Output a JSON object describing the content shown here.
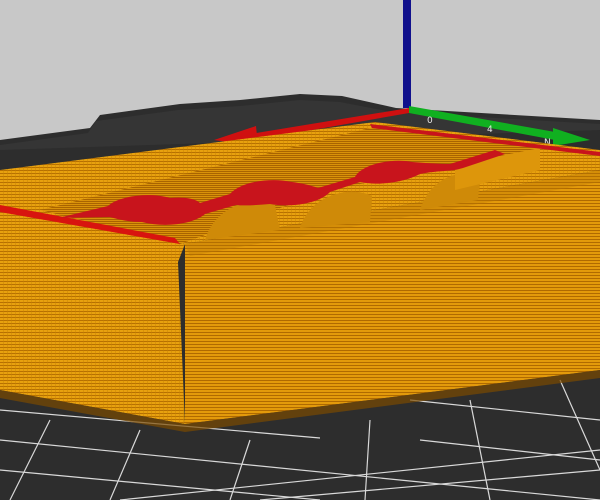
{
  "viewport": {
    "background_color": "#c8c8c8",
    "bed_color": "#2d2d2d",
    "grid_line_color": "#dcdcdc",
    "model_color": "#e69a0a",
    "model_line_color": "#b86e00",
    "cut_face_color": "#c8141c",
    "axis_x_color": "#d01010",
    "axis_y_color": "#10b020",
    "axis_z_color": "#10108c",
    "bed_tick_labels": [
      "0",
      "4",
      "N"
    ]
  }
}
